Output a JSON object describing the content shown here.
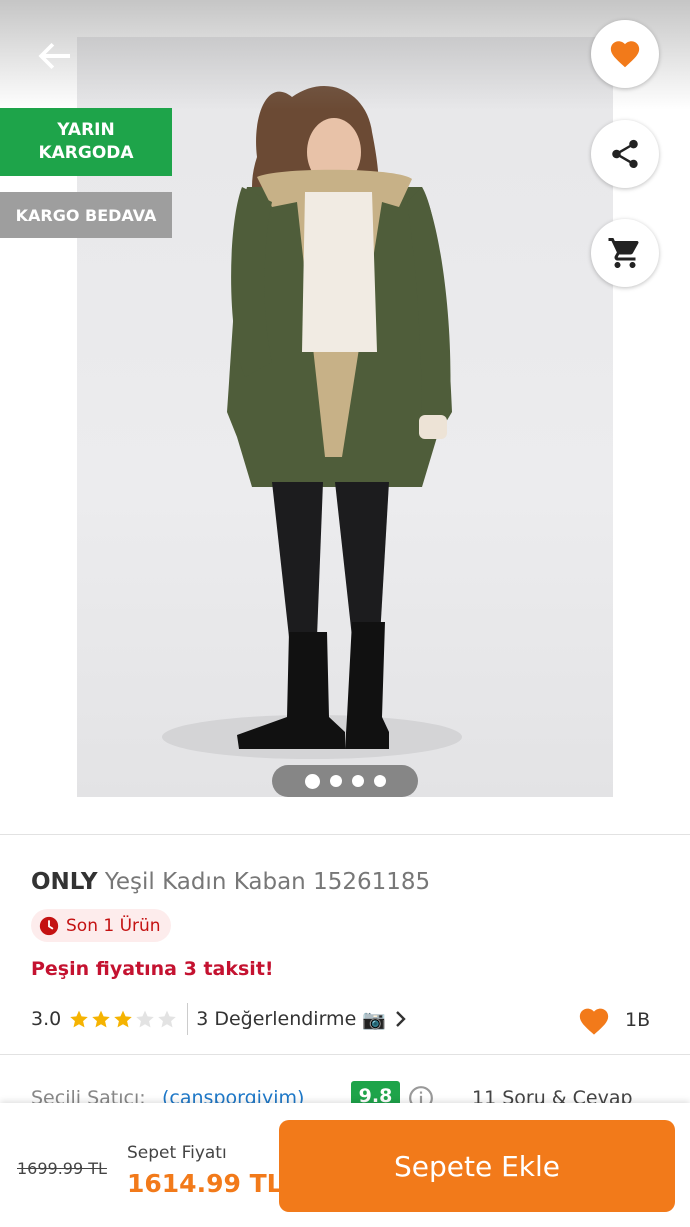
{
  "badges": {
    "shipping": "YARIN KARGODA",
    "free_shipping": "KARGO BEDAVA"
  },
  "gallery": {
    "image_count": 4,
    "active_index": 0,
    "image_alt": "ONLY Yeşil Kadın Kaban model photo"
  },
  "product": {
    "brand": "ONLY",
    "name": "Yeşil Kadın Kaban 15261185",
    "stock_label": "Son 1 Ürün",
    "installment": "Peşin fiyatına 3 taksit!",
    "rating": "3.0",
    "stars_filled": 3,
    "stars_total": 5,
    "review_label": "3 Değerlendirme",
    "review_emoji": "📷",
    "favorite_count": "1B"
  },
  "seller": {
    "label": "Seçili Satıcı:",
    "name": "(cansporgiyim)",
    "score": "9.8",
    "qa_label": "11 Soru & Cevap"
  },
  "purchase": {
    "old_price": "1699.99 TL",
    "price_label": "Sepet Fiyatı",
    "price": "1614.99 TL",
    "button": "Sepete Ekle"
  },
  "colors": {
    "accent": "#f27a1a",
    "green": "#1ea44a",
    "alert": "#c41230",
    "link": "#1e78c8",
    "star": "#f5b301"
  }
}
